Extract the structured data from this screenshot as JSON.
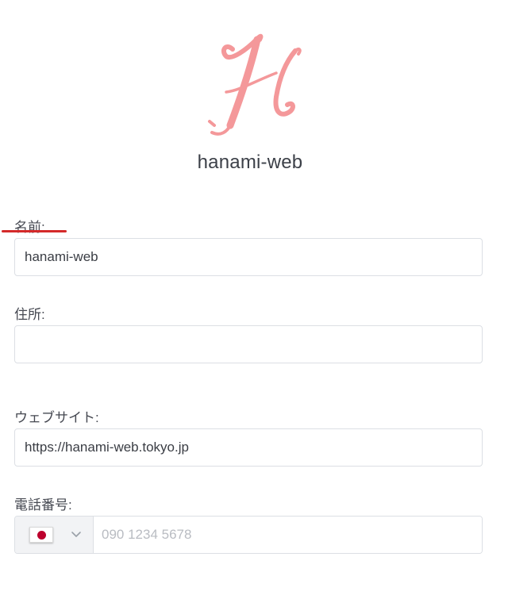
{
  "brand": {
    "logo_icon": "script-h-logo-icon",
    "name": "hanami-web",
    "accent_color": "#f4989a"
  },
  "form": {
    "name": {
      "label": "名前:",
      "value": "hanami-web"
    },
    "address": {
      "label": "住所:",
      "value": ""
    },
    "website": {
      "label": "ウェブサイト:",
      "value": "https://hanami-web.tokyo.jp"
    },
    "phone": {
      "label": "電話番号:",
      "country_icon": "japan-flag-icon",
      "value": "",
      "placeholder": "090 1234 5678"
    }
  },
  "annotation": {
    "underline_color": "#d42a2a"
  }
}
